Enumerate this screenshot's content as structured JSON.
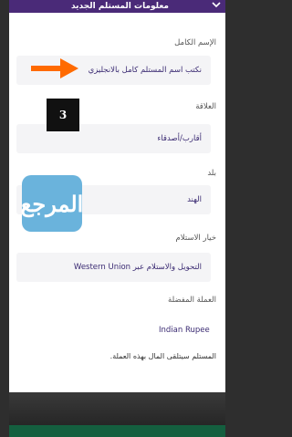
{
  "header": {
    "title": "معلومات المستلم الجديد",
    "chevron_icon": "chevron-down-icon"
  },
  "form": {
    "full_name": {
      "label": "الإسم الكامل",
      "value": "نكتب اسم  المستلم كامل بالانجليزي"
    },
    "relationship": {
      "label": "العلاقة",
      "value": "أقارب/أصدقاء"
    },
    "country": {
      "label": "بلد",
      "value": "الهند"
    },
    "delivery": {
      "label": "خيار الاستلام",
      "value": "التحويل والاستلام عبر Western Union"
    },
    "currency": {
      "label": "العملة المفضلة",
      "value": "Indian Rupee"
    },
    "note": "المستلم سيتلقى المال بهذه العملة."
  },
  "overlay": {
    "badge": "3",
    "arrow_color": "#ff6a00",
    "logo_text": "المرجع"
  },
  "colors": {
    "header_bg": "#4a2a78",
    "value_text": "#3a2a72",
    "field_bg": "#f4f4f6"
  }
}
